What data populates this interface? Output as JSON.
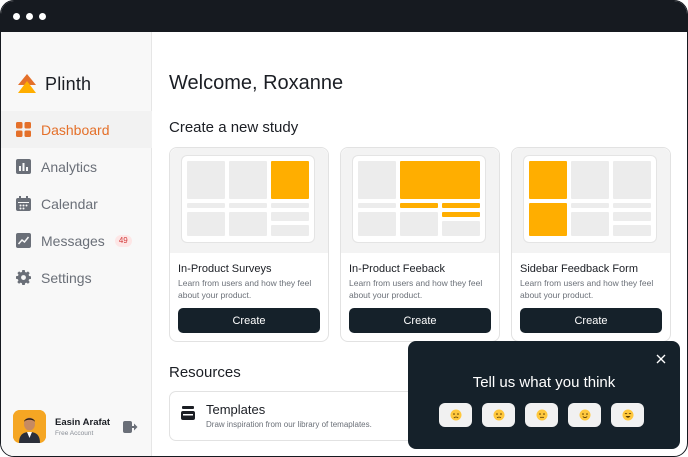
{
  "app": {
    "name": "Plinth"
  },
  "sidebar": {
    "items": [
      {
        "label": "Dashboard",
        "icon": "grid-icon",
        "active": true
      },
      {
        "label": "Analytics",
        "icon": "bar-chart-icon"
      },
      {
        "label": "Calendar",
        "icon": "calendar-icon"
      },
      {
        "label": "Messages",
        "icon": "line-chart-icon",
        "badge": "49"
      },
      {
        "label": "Settings",
        "icon": "gear-icon"
      }
    ],
    "user": {
      "name": "Easin Arafat",
      "role": "Free Account"
    }
  },
  "main": {
    "welcome": "Welcome, Roxanne",
    "create_section_title": "Create a new study",
    "cards": [
      {
        "title": "In-Product Surveys",
        "desc": "Learn from users and how they feel about your product.",
        "button": "Create"
      },
      {
        "title": "In-Product Feeback",
        "desc": "Learn from users and how they feel about your product.",
        "button": "Create"
      },
      {
        "title": "Sidebar Feedback Form",
        "desc": "Learn from users and how they feel about your product.",
        "button": "Create"
      }
    ],
    "resources_title": "Resources",
    "resource": {
      "title": "Templates",
      "desc": "Draw inspiration from our library of temaplates."
    }
  },
  "feedback_popup": {
    "title": "Tell us what you think",
    "options": [
      "very-sad-emoji",
      "sad-emoji",
      "neutral-emoji",
      "happy-emoji",
      "very-happy-emoji"
    ]
  },
  "colors": {
    "accent": "#e4702a",
    "yellow": "#ffae00",
    "dark": "#15212a"
  }
}
